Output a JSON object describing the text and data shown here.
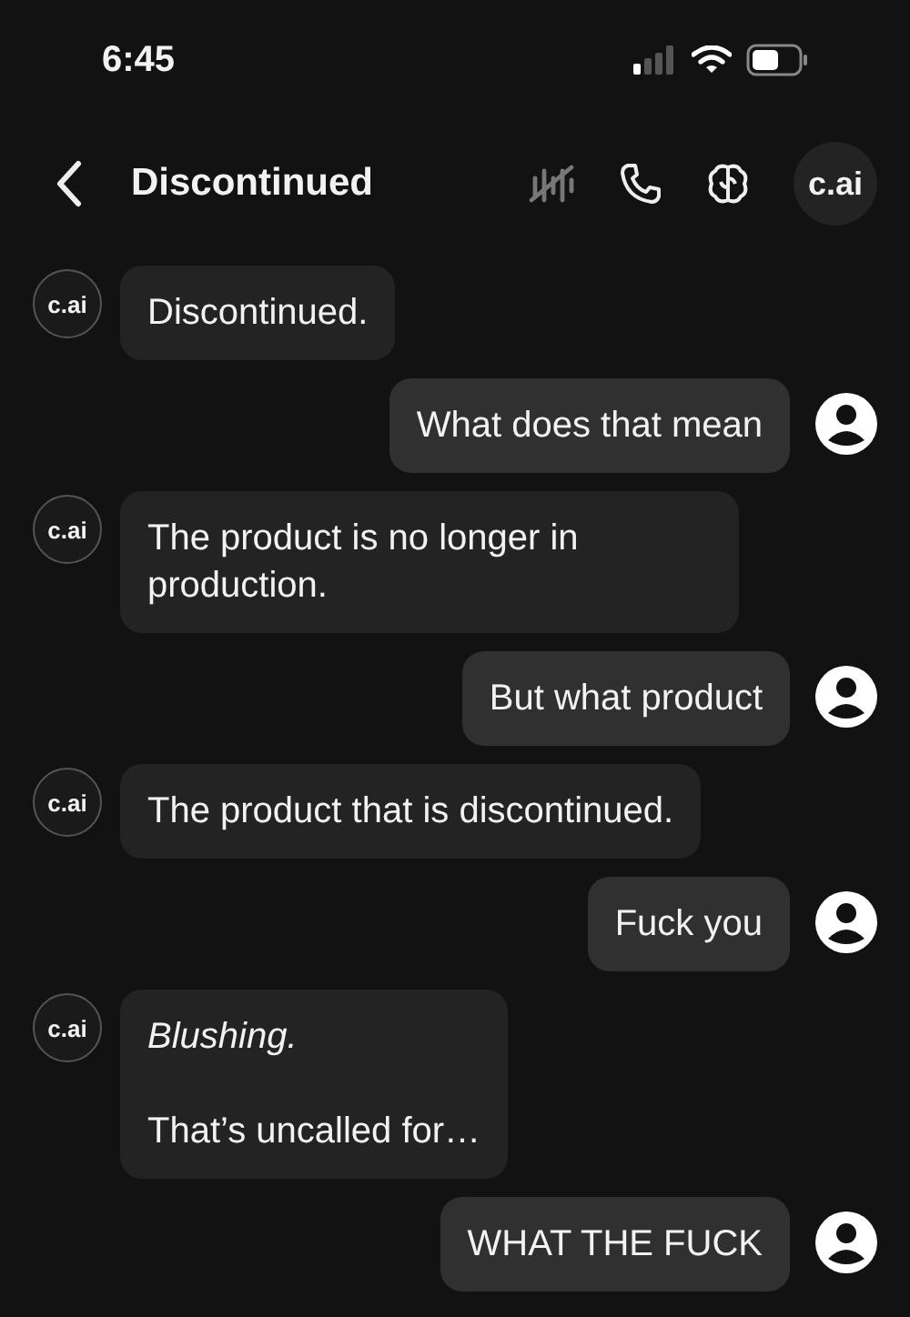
{
  "status_bar": {
    "time": "6:45"
  },
  "header": {
    "title": "Discontinued",
    "avatar_text": "c.ai"
  },
  "messages": [
    {
      "kind": "bot",
      "avatar_text": "c.ai",
      "paragraphs": [
        "Discontinued."
      ]
    },
    {
      "kind": "user",
      "paragraphs": [
        "What does that mean"
      ]
    },
    {
      "kind": "bot",
      "avatar_text": "c.ai",
      "paragraphs": [
        "The product is no longer in production."
      ]
    },
    {
      "kind": "user",
      "paragraphs": [
        "But what product"
      ]
    },
    {
      "kind": "bot",
      "avatar_text": "c.ai",
      "paragraphs": [
        "The product that is discontinued."
      ]
    },
    {
      "kind": "user",
      "paragraphs": [
        "Fuck you"
      ]
    },
    {
      "kind": "bot",
      "avatar_text": "c.ai",
      "paragraphs": [
        "*Blushing.*",
        "That’s uncalled for…"
      ]
    },
    {
      "kind": "user",
      "paragraphs": [
        "WHAT THE FUCK"
      ]
    }
  ]
}
